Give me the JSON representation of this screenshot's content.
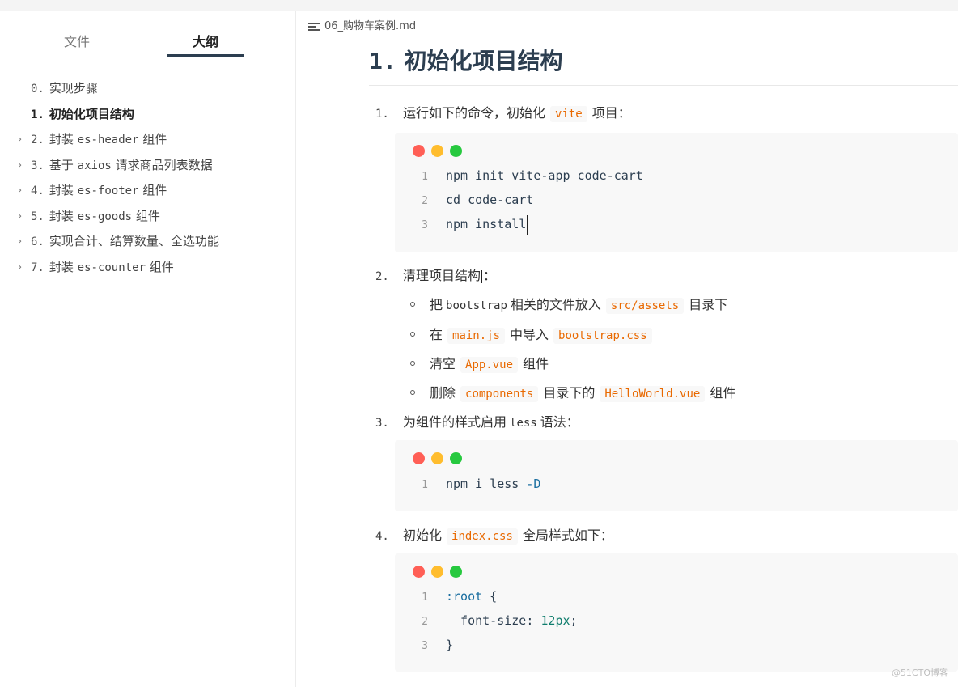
{
  "sidebar": {
    "tabs": {
      "file": "文件",
      "outline": "大纲"
    },
    "items": [
      {
        "num": "0.",
        "label": "实现步骤",
        "chevron": "",
        "active": false
      },
      {
        "num": "1.",
        "label": "初始化项目结构",
        "chevron": "",
        "active": true
      },
      {
        "num": "2.",
        "label_pre": "封装",
        "label_code": "es-header",
        "label_post": "组件",
        "chevron": "›"
      },
      {
        "num": "3.",
        "label_pre": "基于",
        "label_code": "axios",
        "label_post": "请求商品列表数据",
        "chevron": "›"
      },
      {
        "num": "4.",
        "label_pre": "封装",
        "label_code": "es-footer",
        "label_post": "组件",
        "chevron": "›"
      },
      {
        "num": "5.",
        "label_pre": "封装",
        "label_code": "es-goods",
        "label_post": "组件",
        "chevron": "›"
      },
      {
        "num": "6.",
        "label": "实现合计、结算数量、全选功能",
        "chevron": "›"
      },
      {
        "num": "7.",
        "label_pre": "封装",
        "label_code": "es-counter",
        "label_post": "组件",
        "chevron": "›"
      }
    ]
  },
  "main": {
    "filename": "06_购物车案例.md",
    "heading": {
      "num": "1.",
      "text": "初始化项目结构"
    },
    "steps": [
      {
        "num": "1.",
        "pre": "运行如下的命令，初始化",
        "code": "vite",
        "post": "项目："
      },
      {
        "num": "2.",
        "pre": "清理项目结构",
        "post": "："
      },
      {
        "num": "3.",
        "pre": "为组件的样式启用",
        "code": "less",
        "post": "语法："
      },
      {
        "num": "4.",
        "pre": "初始化",
        "code": "index.css",
        "post": "全局样式如下："
      }
    ],
    "bullets": [
      {
        "pre": "把",
        "mono": "bootstrap",
        "mid": "相关的文件放入",
        "code": "src/assets",
        "post": "目录下"
      },
      {
        "pre": "在",
        "code": "main.js",
        "mid": "中导入",
        "code2": "bootstrap.css"
      },
      {
        "pre": "清空",
        "code": "App.vue",
        "post": "组件"
      },
      {
        "pre": "删除",
        "code": "components",
        "mid": "目录下的",
        "code2": "HelloWorld.vue",
        "post": "组件"
      }
    ],
    "code1": [
      {
        "ln": "1",
        "text": "npm init vite-app code-cart"
      },
      {
        "ln": "2",
        "text": "cd code-cart"
      },
      {
        "ln": "3",
        "text": "npm install"
      }
    ],
    "code2": [
      {
        "ln": "1",
        "cmd": "npm i less",
        "flag": "-D"
      }
    ],
    "code3": [
      {
        "ln": "1",
        "sel": ":root",
        "rest": " {"
      },
      {
        "ln": "2",
        "prop": "  font-size:",
        "val": " 12px",
        "rest": ";"
      },
      {
        "ln": "3",
        "rest": "}"
      }
    ]
  },
  "watermark": "@51CTO博客",
  "colors": {
    "heading": "#2c3e50",
    "inline_code": "#e96900",
    "code_bg": "#f8f8f8",
    "mac_red": "#ff5f56",
    "mac_yellow": "#ffbd2e",
    "mac_green": "#27c93f"
  }
}
